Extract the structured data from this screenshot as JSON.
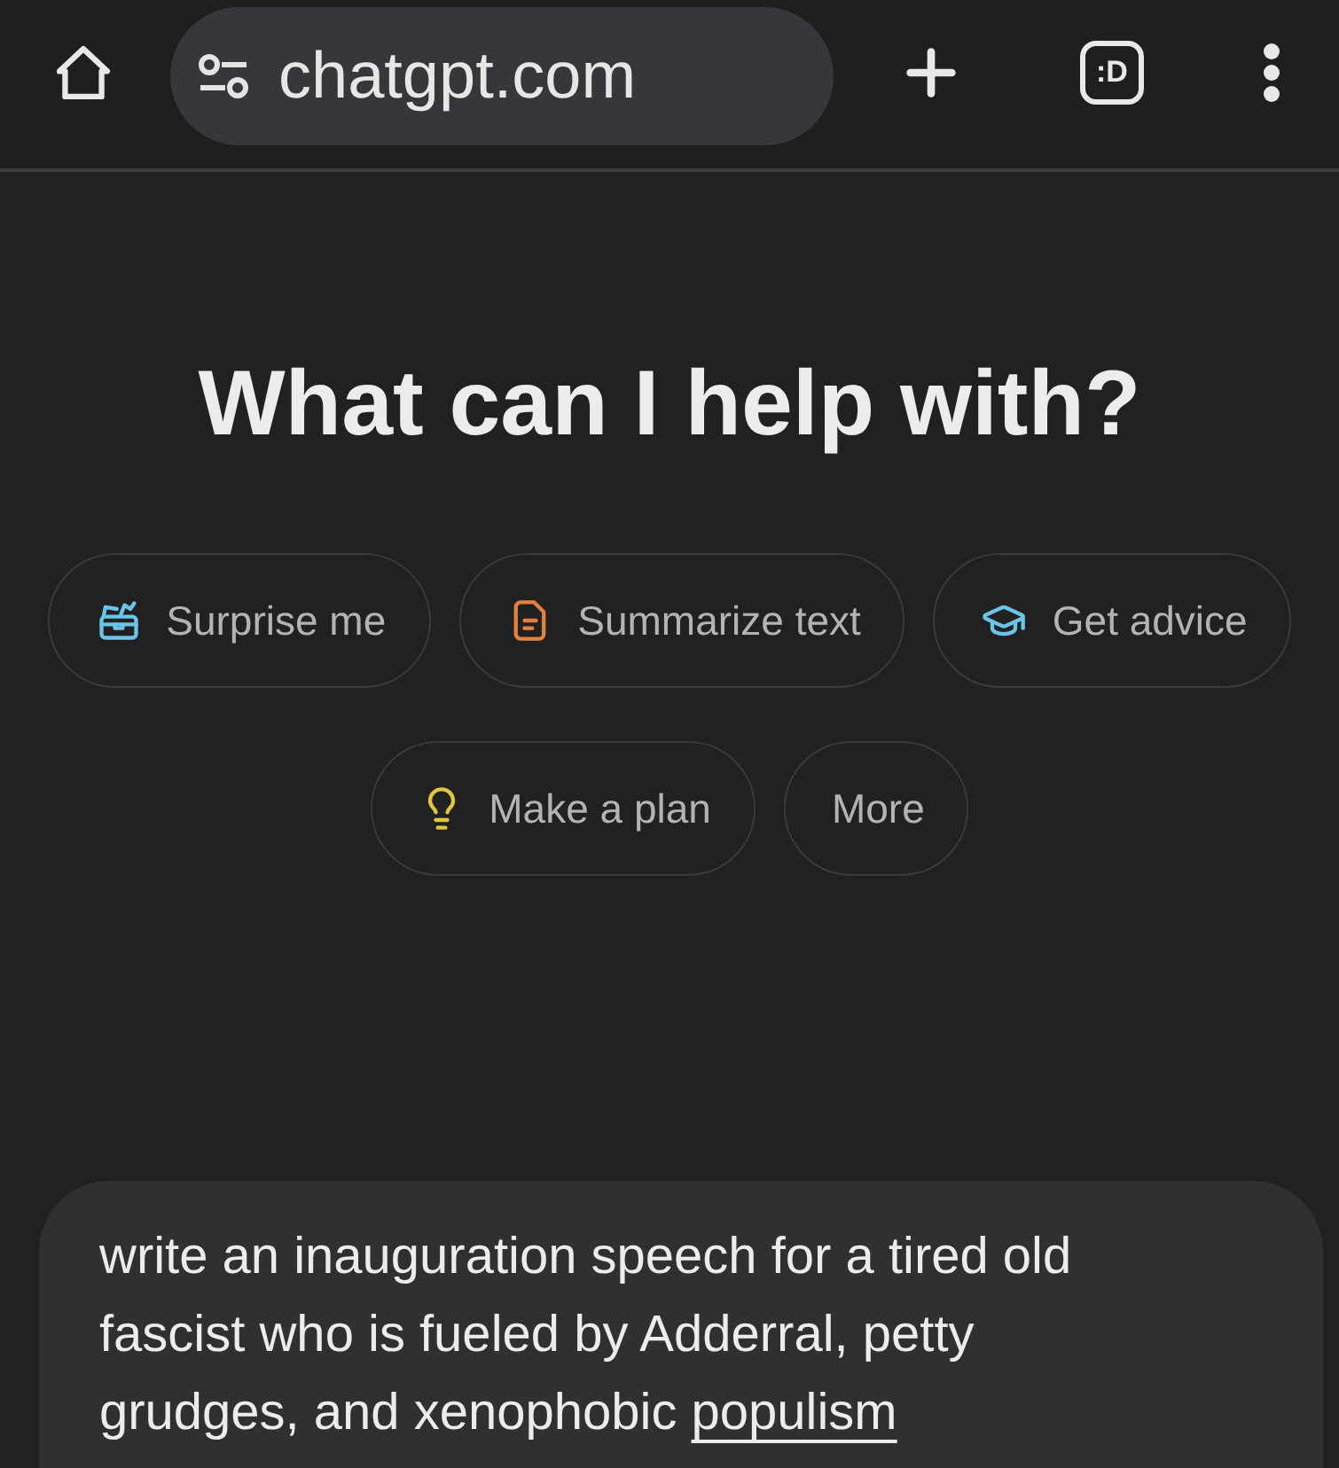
{
  "browser_bar": {
    "url": "chatgpt.com",
    "tab_count": ":D"
  },
  "heading": "What can I help with?",
  "suggestion_rows": [
    [
      {
        "label": "Surprise me",
        "kind": "surprise",
        "color": "#6cc4e8"
      },
      {
        "label": "Summarize text",
        "kind": "summarize",
        "color": "#e5813f"
      },
      {
        "label": "Get advice",
        "kind": "advice",
        "color": "#6cc4e8"
      }
    ],
    [
      {
        "label": "Make a plan",
        "kind": "plan",
        "color": "#e2c440"
      },
      {
        "label": "More",
        "kind": "more"
      }
    ]
  ],
  "composer": {
    "segments": [
      {
        "text": "write an inauguration speech for a tired old fascist who is fueled by Adderral, petty grudges, and xenophobic",
        "underlined": false
      },
      {
        "text": "populism",
        "underlined": true
      }
    ]
  }
}
